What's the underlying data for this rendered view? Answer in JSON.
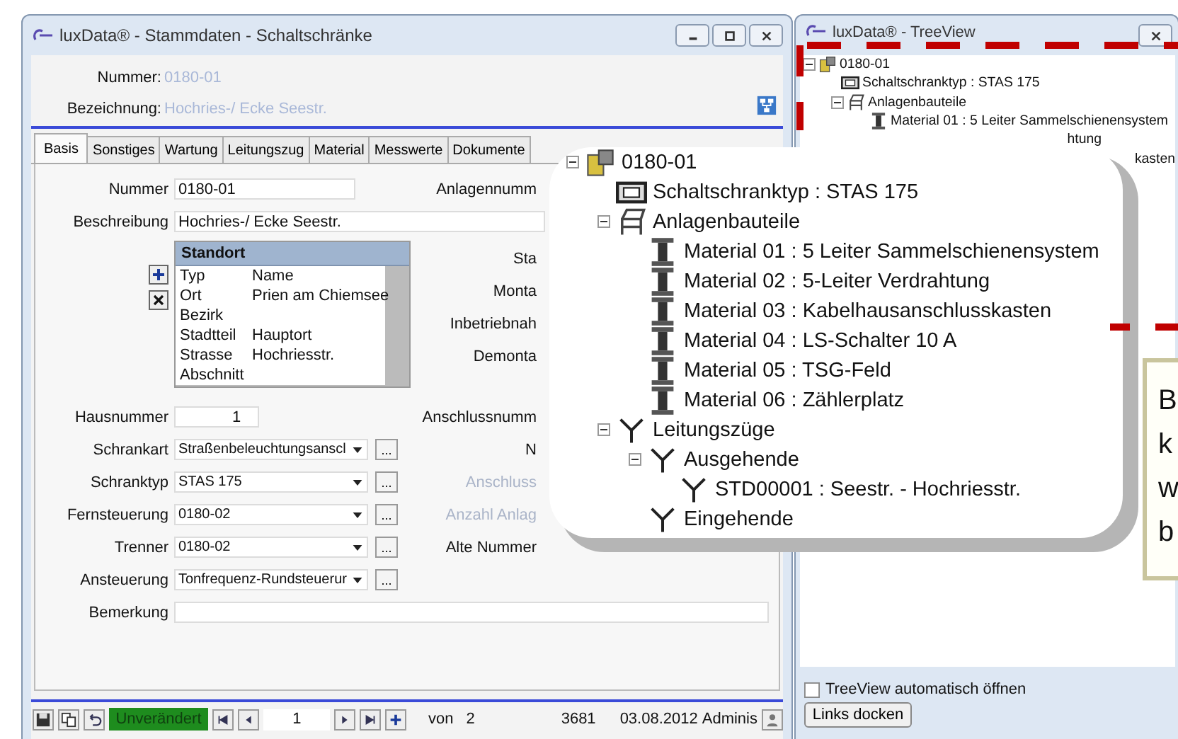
{
  "main_window": {
    "title": "luxData® - Stammdaten - Schaltschränke",
    "header": [
      {
        "label": "Nummer:",
        "value": "0180-01"
      },
      {
        "label": "Bezeichnung:",
        "value": "Hochries-/ Ecke Seestr."
      }
    ],
    "tabs": [
      {
        "label": "Basis",
        "selected": true
      },
      {
        "label": "Sonstiges",
        "selected": false
      },
      {
        "label": "Wartung",
        "selected": false
      },
      {
        "label": "Leitungszug",
        "selected": false
      },
      {
        "label": "Material",
        "selected": false
      },
      {
        "label": "Messwerte",
        "selected": false
      },
      {
        "label": "Dokumente",
        "selected": false
      }
    ],
    "top_fields": [
      {
        "label": "Nummer",
        "value": "0180-01"
      },
      {
        "label": "Beschreibung",
        "value": "Hochries-/ Ecke Seestr."
      }
    ],
    "location": {
      "title": "Standort",
      "columns": [
        "Typ",
        "Name"
      ],
      "rows": [
        {
          "type": "Ort",
          "name": "Prien am Chiemsee"
        },
        {
          "type": "Bezirk"
        },
        {
          "type": "Stadtteil",
          "name": "Hauptort"
        },
        {
          "type": "Strasse",
          "name": "Hochriesstr."
        },
        {
          "type": "Abschnitt"
        }
      ]
    },
    "lower_fields": [
      {
        "kind": "number",
        "label": "Hausnummer",
        "value": "1"
      },
      {
        "kind": "combo",
        "label": "Schrankart",
        "value": "Straßenbeleuchtungsanscl",
        "button": "..."
      },
      {
        "kind": "combo",
        "label": "Schranktyp",
        "value": "STAS 175",
        "button": "..."
      },
      {
        "kind": "combo",
        "label": "Fernsteuerung",
        "value": "0180-02",
        "button": "..."
      },
      {
        "kind": "combo",
        "label": "Trenner",
        "value": "0180-02",
        "button": "..."
      },
      {
        "kind": "combo",
        "label": "Ansteuerung",
        "value": "Tonfrequenz-Rundsteuerur",
        "button": "..."
      },
      {
        "kind": "memo",
        "label": "Bemerkung"
      }
    ],
    "right_labels": [
      {
        "label": "Anlagennumm",
        "disabled": false
      },
      {
        "label": "Sta",
        "disabled": false
      },
      {
        "label": "Monta",
        "disabled": false
      },
      {
        "label": "Inbetriebnah",
        "disabled": false
      },
      {
        "label": "Demonta",
        "disabled": false
      },
      {
        "label": "Anschlussnumm",
        "disabled": false
      },
      {
        "label": "N",
        "disabled": false
      },
      {
        "label": "Anschluss",
        "disabled": true
      },
      {
        "label": "Anzahl Anlag",
        "disabled": true
      },
      {
        "label": "Alte Nummer",
        "disabled": false
      }
    ],
    "toolbar": {
      "status": "Unverändert",
      "page": "1",
      "of_label": "von",
      "page_count": "2",
      "record_id": "3681",
      "date": "03.08.2012",
      "user": "Adminis"
    }
  },
  "tree_window": {
    "title": "luxData® - TreeView",
    "tree": [
      {
        "label": "0180-01",
        "kind": "root",
        "expanded": true,
        "children": [
          {
            "label": "Schaltschranktyp : STAS 175",
            "kind": "cabinet"
          },
          {
            "label": "Anlagenbauteile",
            "kind": "parts",
            "expanded": true,
            "children": [
              {
                "label": "Material 01 : 5 Leiter Sammelschienensystem",
                "kind": "material"
              },
              {
                "label": "htung",
                "kind": "fragment"
              },
              {
                "label": "kasten",
                "kind": "fragment"
              }
            ]
          }
        ]
      }
    ],
    "auto_open": {
      "label": "TreeView automatisch öffnen",
      "checked": false
    },
    "dock_button": "Links docken"
  },
  "callout": {
    "tree": [
      {
        "label": "0180-01",
        "kind": "root",
        "expanded": true,
        "children": [
          {
            "label": "Schaltschranktyp : STAS 175",
            "kind": "cabinet"
          },
          {
            "label": "Anlagenbauteile",
            "kind": "parts",
            "expanded": true,
            "children": [
              {
                "label": "Material 01 : 5 Leiter Sammelschienensystem",
                "kind": "material"
              },
              {
                "label": "Material 02 : 5-Leiter Verdrahtung",
                "kind": "material"
              },
              {
                "label": "Material 03 : Kabelhausanschlusskasten",
                "kind": "material"
              },
              {
                "label": "Material 04 : LS-Schalter 10 A",
                "kind": "material"
              },
              {
                "label": "Material 05 : TSG-Feld",
                "kind": "material"
              },
              {
                "label": "Material 06 : Zählerplatz",
                "kind": "material"
              }
            ]
          },
          {
            "label": "Leitungszüge",
            "kind": "line",
            "expanded": true,
            "children": [
              {
                "label": "Ausgehende",
                "kind": "line",
                "expanded": true,
                "children": [
                  {
                    "label": "STD00001 : Seestr. - Hochriesstr.",
                    "kind": "line"
                  }
                ]
              },
              {
                "label": "Eingehende",
                "kind": "line"
              }
            ]
          }
        ]
      }
    ]
  },
  "note": {
    "lines": [
      "B",
      "k",
      "w",
      "b"
    ]
  }
}
